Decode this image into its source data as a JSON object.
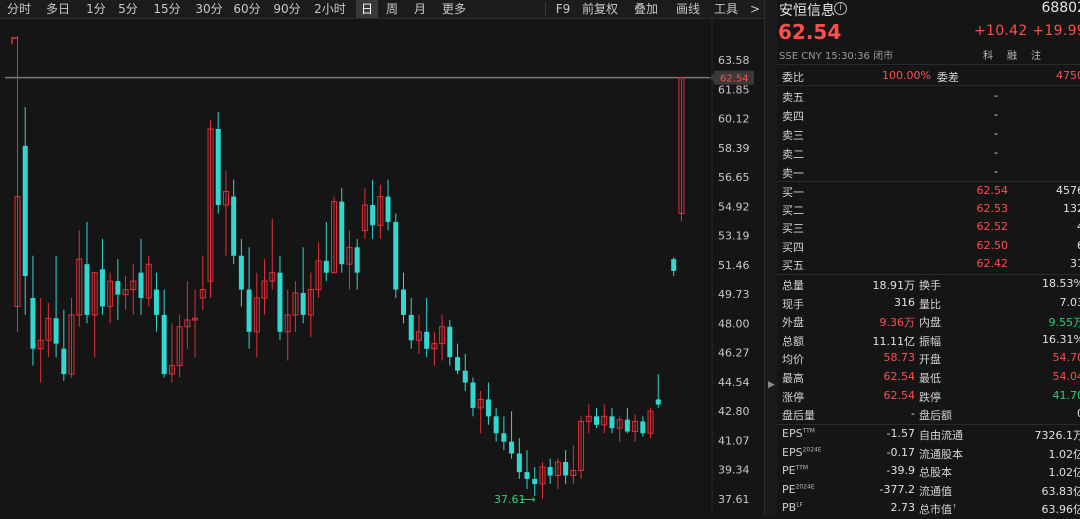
{
  "toolbar": {
    "periods": [
      "分时",
      "多日",
      "1分",
      "5分",
      "15分",
      "30分",
      "60分",
      "90分",
      "2小时",
      "日",
      "周",
      "月",
      "更多"
    ],
    "active": "日",
    "tools": [
      "F9",
      "前复权",
      "叠加",
      "画线",
      "工具"
    ],
    "more_arrow": ">"
  },
  "stock": {
    "name": "安恒信息",
    "code": "68802",
    "info_icon": "i",
    "price": "62.54",
    "change": "+10.42",
    "change_pct": "+19.99",
    "exchange": "SSE",
    "currency": "CNY",
    "time": "15:30:36",
    "status": "闭市",
    "tags": [
      "科",
      "融",
      "注"
    ]
  },
  "order_book": {
    "ratio": {
      "label": "委比",
      "value": "100.00%",
      "diff_label": "委差",
      "diff_value": "4750"
    },
    "sells": [
      {
        "label": "卖五",
        "price": "-",
        "vol": "-"
      },
      {
        "label": "卖四",
        "price": "-",
        "vol": "-"
      },
      {
        "label": "卖三",
        "price": "-",
        "vol": "-"
      },
      {
        "label": "卖二",
        "price": "-",
        "vol": "-"
      },
      {
        "label": "卖一",
        "price": "-",
        "vol": "-"
      }
    ],
    "buys": [
      {
        "label": "买一",
        "price": "62.54",
        "vol": "4576"
      },
      {
        "label": "买二",
        "price": "62.53",
        "vol": "132"
      },
      {
        "label": "买三",
        "price": "62.52",
        "vol": "4"
      },
      {
        "label": "买四",
        "price": "62.50",
        "vol": "6"
      },
      {
        "label": "买五",
        "price": "62.42",
        "vol": "31"
      }
    ]
  },
  "stats": [
    {
      "l1": "总量",
      "v1": "18.91万",
      "c1": "white",
      "l2": "换手",
      "v2": "18.53%",
      "c2": "white"
    },
    {
      "l1": "现手",
      "v1": "316",
      "c1": "white",
      "l2": "量比",
      "v2": "7.03",
      "c2": "white"
    },
    {
      "l1": "外盘",
      "v1": "9.36万",
      "c1": "red",
      "l2": "内盘",
      "v2": "9.55万",
      "c2": "green"
    },
    {
      "l1": "总额",
      "v1": "11.11亿",
      "c1": "white",
      "l2": "振幅",
      "v2": "16.31%",
      "c2": "white"
    },
    {
      "l1": "均价",
      "v1": "58.73",
      "c1": "red",
      "l2": "开盘",
      "v2": "54.70",
      "c2": "red"
    },
    {
      "l1": "最高",
      "v1": "62.54",
      "c1": "red",
      "l2": "最低",
      "v2": "54.04",
      "c2": "red"
    },
    {
      "l1": "涨停",
      "v1": "62.54",
      "c1": "red",
      "l2": "跌停",
      "v2": "41.70",
      "c2": "green"
    },
    {
      "l1": "盘后量",
      "v1": "-",
      "c1": "white",
      "l2": "盘后额",
      "v2": "0",
      "c2": "white"
    }
  ],
  "fundamentals": [
    {
      "l1": "EPS",
      "s1": "TTM",
      "v1": "-1.57",
      "l2": "自由流通",
      "v2": "7326.1万"
    },
    {
      "l1": "EPS",
      "s1": "2024E",
      "v1": "-0.17",
      "l2": "流通股本",
      "v2": "1.02亿"
    },
    {
      "l1": "PE",
      "s1": "TTM",
      "v1": "-39.9",
      "l2": "总股本",
      "v2": "1.02亿"
    },
    {
      "l1": "PE",
      "s1": "2024E",
      "v1": "-377.2",
      "l2": "流通值",
      "v2": "63.83亿"
    },
    {
      "l1": "PB",
      "s1": "LF",
      "v1": "2.73",
      "l2": "总市值",
      "s2": "↑",
      "v2": "63.96亿"
    }
  ],
  "chart_data": {
    "type": "candlestick",
    "y_ticks": [
      "63.58",
      "61.85",
      "60.12",
      "58.39",
      "56.65",
      "54.92",
      "53.19",
      "51.46",
      "49.73",
      "48.00",
      "46.27",
      "44.54",
      "42.80",
      "41.07",
      "39.34",
      "37.61"
    ],
    "ylim": [
      37.61,
      63.58
    ],
    "current_price_label": "62.54",
    "low_annotation": "37.61",
    "low_arrow": "⟶",
    "up_color": "#e0303a",
    "down_color": "#31d8d0",
    "candles": [
      {
        "o": 49.0,
        "h": 65.0,
        "l": 47.5,
        "c": 55.5
      },
      {
        "o": 58.5,
        "h": 60.8,
        "l": 48.5,
        "c": 50.8
      },
      {
        "o": 49.5,
        "h": 52.0,
        "l": 45.5,
        "c": 46.5
      },
      {
        "o": 46.5,
        "h": 49.5,
        "l": 44.5,
        "c": 47.0
      },
      {
        "o": 47.0,
        "h": 49.2,
        "l": 46.0,
        "c": 48.3
      },
      {
        "o": 48.3,
        "h": 52.0,
        "l": 46.0,
        "c": 46.8
      },
      {
        "o": 46.5,
        "h": 48.8,
        "l": 44.6,
        "c": 45.0
      },
      {
        "o": 45.0,
        "h": 49.5,
        "l": 44.8,
        "c": 48.5
      },
      {
        "o": 48.5,
        "h": 53.5,
        "l": 47.8,
        "c": 51.8
      },
      {
        "o": 51.5,
        "h": 54.0,
        "l": 48.0,
        "c": 48.5
      },
      {
        "o": 48.5,
        "h": 51.0,
        "l": 46.0,
        "c": 51.0
      },
      {
        "o": 51.2,
        "h": 53.0,
        "l": 48.5,
        "c": 49.0
      },
      {
        "o": 49.0,
        "h": 51.0,
        "l": 48.0,
        "c": 50.5
      },
      {
        "o": 50.5,
        "h": 51.8,
        "l": 48.2,
        "c": 49.7
      },
      {
        "o": 49.7,
        "h": 50.8,
        "l": 48.8,
        "c": 50.0
      },
      {
        "o": 50.0,
        "h": 51.5,
        "l": 48.5,
        "c": 50.5
      },
      {
        "o": 51.0,
        "h": 53.0,
        "l": 48.5,
        "c": 49.5
      },
      {
        "o": 49.5,
        "h": 52.0,
        "l": 49.0,
        "c": 51.5
      },
      {
        "o": 50.0,
        "h": 51.0,
        "l": 47.5,
        "c": 48.5
      },
      {
        "o": 48.5,
        "h": 50.0,
        "l": 44.8,
        "c": 45.0
      },
      {
        "o": 45.0,
        "h": 48.0,
        "l": 44.5,
        "c": 45.5
      },
      {
        "o": 45.5,
        "h": 48.5,
        "l": 44.8,
        "c": 47.8
      },
      {
        "o": 47.8,
        "h": 50.5,
        "l": 46.5,
        "c": 48.2
      },
      {
        "o": 48.2,
        "h": 50.0,
        "l": 46.0,
        "c": 48.3
      },
      {
        "o": 49.5,
        "h": 52.0,
        "l": 48.8,
        "c": 50.0
      },
      {
        "o": 50.5,
        "h": 60.0,
        "l": 49.5,
        "c": 59.5
      },
      {
        "o": 59.5,
        "h": 60.5,
        "l": 54.5,
        "c": 55.0
      },
      {
        "o": 55.0,
        "h": 57.0,
        "l": 52.0,
        "c": 55.8
      },
      {
        "o": 55.5,
        "h": 56.5,
        "l": 51.5,
        "c": 52.0
      },
      {
        "o": 52.0,
        "h": 53.0,
        "l": 49.0,
        "c": 50.0
      },
      {
        "o": 50.0,
        "h": 52.5,
        "l": 46.5,
        "c": 47.5
      },
      {
        "o": 47.5,
        "h": 51.0,
        "l": 46.0,
        "c": 49.5
      },
      {
        "o": 49.5,
        "h": 51.8,
        "l": 48.5,
        "c": 50.5
      },
      {
        "o": 50.5,
        "h": 54.2,
        "l": 50.0,
        "c": 51.0
      },
      {
        "o": 51.0,
        "h": 52.0,
        "l": 47.0,
        "c": 47.5
      },
      {
        "o": 47.5,
        "h": 50.0,
        "l": 45.8,
        "c": 48.5
      },
      {
        "o": 48.5,
        "h": 50.5,
        "l": 47.5,
        "c": 49.8
      },
      {
        "o": 49.8,
        "h": 52.5,
        "l": 48.0,
        "c": 48.5
      },
      {
        "o": 48.5,
        "h": 51.0,
        "l": 47.2,
        "c": 50.0
      },
      {
        "o": 50.0,
        "h": 52.8,
        "l": 49.5,
        "c": 51.7
      },
      {
        "o": 51.7,
        "h": 54.0,
        "l": 50.5,
        "c": 51.0
      },
      {
        "o": 51.0,
        "h": 55.5,
        "l": 51.0,
        "c": 55.2
      },
      {
        "o": 55.2,
        "h": 56.0,
        "l": 51.0,
        "c": 51.5
      },
      {
        "o": 51.5,
        "h": 53.5,
        "l": 50.0,
        "c": 52.5
      },
      {
        "o": 52.5,
        "h": 53.0,
        "l": 50.0,
        "c": 51.0
      },
      {
        "o": 53.5,
        "h": 56.0,
        "l": 53.0,
        "c": 55.0
      },
      {
        "o": 55.0,
        "h": 56.5,
        "l": 53.0,
        "c": 53.8
      },
      {
        "o": 53.8,
        "h": 56.2,
        "l": 53.0,
        "c": 55.5
      },
      {
        "o": 55.5,
        "h": 56.5,
        "l": 53.5,
        "c": 54.0
      },
      {
        "o": 54.0,
        "h": 54.5,
        "l": 49.5,
        "c": 50.0
      },
      {
        "o": 50.0,
        "h": 51.0,
        "l": 48.0,
        "c": 48.5
      },
      {
        "o": 48.5,
        "h": 49.5,
        "l": 46.5,
        "c": 47.0
      },
      {
        "o": 47.0,
        "h": 48.5,
        "l": 46.2,
        "c": 47.5
      },
      {
        "o": 47.5,
        "h": 49.5,
        "l": 46.0,
        "c": 46.5
      },
      {
        "o": 46.5,
        "h": 47.5,
        "l": 45.5,
        "c": 46.8
      },
      {
        "o": 46.8,
        "h": 48.5,
        "l": 45.8,
        "c": 47.8
      },
      {
        "o": 47.8,
        "h": 48.2,
        "l": 45.5,
        "c": 46.0
      },
      {
        "o": 46.0,
        "h": 46.8,
        "l": 45.0,
        "c": 45.2
      },
      {
        "o": 45.2,
        "h": 46.2,
        "l": 44.0,
        "c": 44.5
      },
      {
        "o": 44.5,
        "h": 44.8,
        "l": 42.5,
        "c": 43.0
      },
      {
        "o": 43.0,
        "h": 44.0,
        "l": 41.5,
        "c": 43.5
      },
      {
        "o": 43.5,
        "h": 44.5,
        "l": 42.0,
        "c": 42.5
      },
      {
        "o": 42.5,
        "h": 43.0,
        "l": 41.0,
        "c": 41.5
      },
      {
        "o": 41.5,
        "h": 42.5,
        "l": 40.5,
        "c": 41.0
      },
      {
        "o": 41.0,
        "h": 42.8,
        "l": 40.0,
        "c": 40.3
      },
      {
        "o": 40.3,
        "h": 41.2,
        "l": 38.8,
        "c": 39.2
      },
      {
        "o": 39.2,
        "h": 40.5,
        "l": 38.2,
        "c": 38.8
      },
      {
        "o": 38.8,
        "h": 39.5,
        "l": 37.8,
        "c": 38.5
      },
      {
        "o": 38.5,
        "h": 39.8,
        "l": 37.61,
        "c": 39.5
      },
      {
        "o": 39.5,
        "h": 40.0,
        "l": 38.5,
        "c": 39.0
      },
      {
        "o": 39.0,
        "h": 40.0,
        "l": 38.2,
        "c": 39.8
      },
      {
        "o": 39.8,
        "h": 40.5,
        "l": 38.5,
        "c": 39.0
      },
      {
        "o": 39.0,
        "h": 40.8,
        "l": 38.5,
        "c": 39.3
      },
      {
        "o": 39.3,
        "h": 42.5,
        "l": 38.8,
        "c": 42.2
      },
      {
        "o": 42.2,
        "h": 43.2,
        "l": 41.5,
        "c": 42.5
      },
      {
        "o": 42.5,
        "h": 43.0,
        "l": 41.8,
        "c": 42.0
      },
      {
        "o": 42.0,
        "h": 43.2,
        "l": 41.5,
        "c": 42.5
      },
      {
        "o": 42.5,
        "h": 43.0,
        "l": 41.5,
        "c": 41.8
      },
      {
        "o": 41.8,
        "h": 42.5,
        "l": 41.0,
        "c": 42.3
      },
      {
        "o": 42.3,
        "h": 43.0,
        "l": 41.5,
        "c": 41.6
      },
      {
        "o": 41.6,
        "h": 42.6,
        "l": 41.0,
        "c": 42.2
      },
      {
        "o": 42.2,
        "h": 42.5,
        "l": 41.3,
        "c": 41.5
      },
      {
        "o": 41.5,
        "h": 43.0,
        "l": 41.2,
        "c": 42.8
      },
      {
        "o": 43.5,
        "h": 45.0,
        "l": 43.0,
        "c": 43.2
      },
      {
        "o": null,
        "h": null,
        "l": null,
        "c": null
      },
      {
        "o": 51.8,
        "h": 51.9,
        "l": 50.8,
        "c": 51.1
      },
      {
        "o": 54.5,
        "h": 62.54,
        "l": 54.04,
        "c": 62.54
      }
    ]
  }
}
